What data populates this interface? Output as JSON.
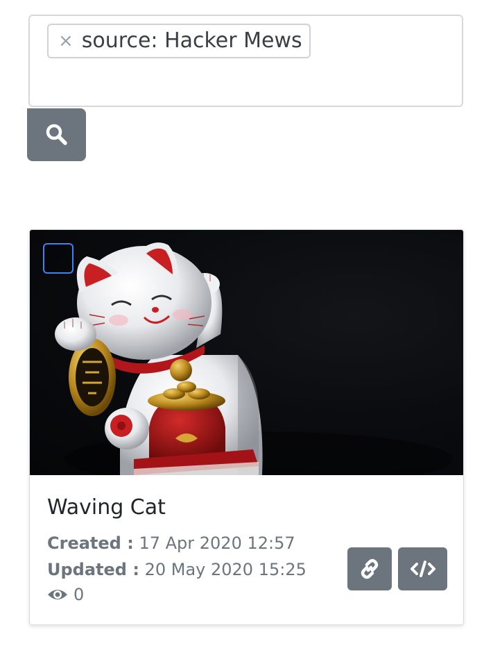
{
  "search": {
    "tags": [
      {
        "label": "source: Hacker Mews",
        "remove_glyph": "×"
      }
    ],
    "submit_icon": "search-icon"
  },
  "colors": {
    "button_bg": "#6c757d",
    "checkbox_border": "#3d83f3",
    "card_border": "#d8dbde",
    "meta_text": "#6c757d",
    "title_text": "#212529"
  },
  "card": {
    "title": "Waving Cat",
    "created_label": "Created :",
    "created_value": "17 Apr 2020 12:57",
    "updated_label": "Updated :",
    "updated_value": "20 May 2020 15:25",
    "views_icon": "eye-icon",
    "views_count": "0",
    "actions": [
      {
        "name": "copy-link",
        "icon": "link-icon"
      },
      {
        "name": "embed-code",
        "icon": "code-icon"
      }
    ]
  }
}
